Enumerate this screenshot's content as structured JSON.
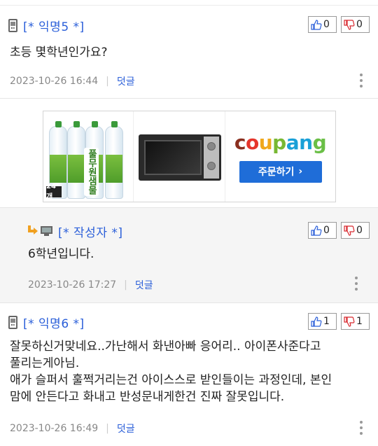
{
  "comments": [
    {
      "author": "[* 익명5 *]",
      "up": "0",
      "down": "0",
      "body": "초등 몇학년인가요?",
      "date": "2023-10-26 16:44",
      "reply_label": "덧글"
    }
  ],
  "reply": {
    "author": "[* 작성자 *]",
    "up": "0",
    "down": "0",
    "body": "6학년입니다.",
    "date": "2023-10-26 17:27",
    "reply_label": "덧글"
  },
  "comment2": {
    "author": "[* 익명6 *]",
    "up": "1",
    "down": "1",
    "body_lines": [
      "잘못하신거맞네요..가난해서 화낸아빠 응어리.. 아이폰사준다고",
      "풀리는게아님.",
      "애가 슬퍼서 훌쩍거리는건 아이스스로 받인들이는 과정인데, 본인",
      "맘에 안든다고 화내고 반성문내게한건 진짜 잘못입니다."
    ],
    "date": "2023-10-26 16:49",
    "reply_label": "덧글"
  },
  "ad": {
    "brand_label": "풀무원샘물",
    "pack_label": "24개",
    "logo_letters": [
      "c",
      "o",
      "u",
      "p",
      "a",
      "n",
      "g"
    ],
    "logo_colors": [
      "#8a2f1f",
      "#e5352b",
      "#f0a81c",
      "#78b833",
      "#1aa0d7",
      "#1aa0d7",
      "#6abf46"
    ],
    "button_label": "주문하기",
    "button_arrow": "›"
  },
  "colors": {
    "author": "#2b5fd9",
    "reply_link": "#2b5fd9",
    "reply_bg": "#f5f5f5",
    "reply_arrow": "#f0a020"
  }
}
